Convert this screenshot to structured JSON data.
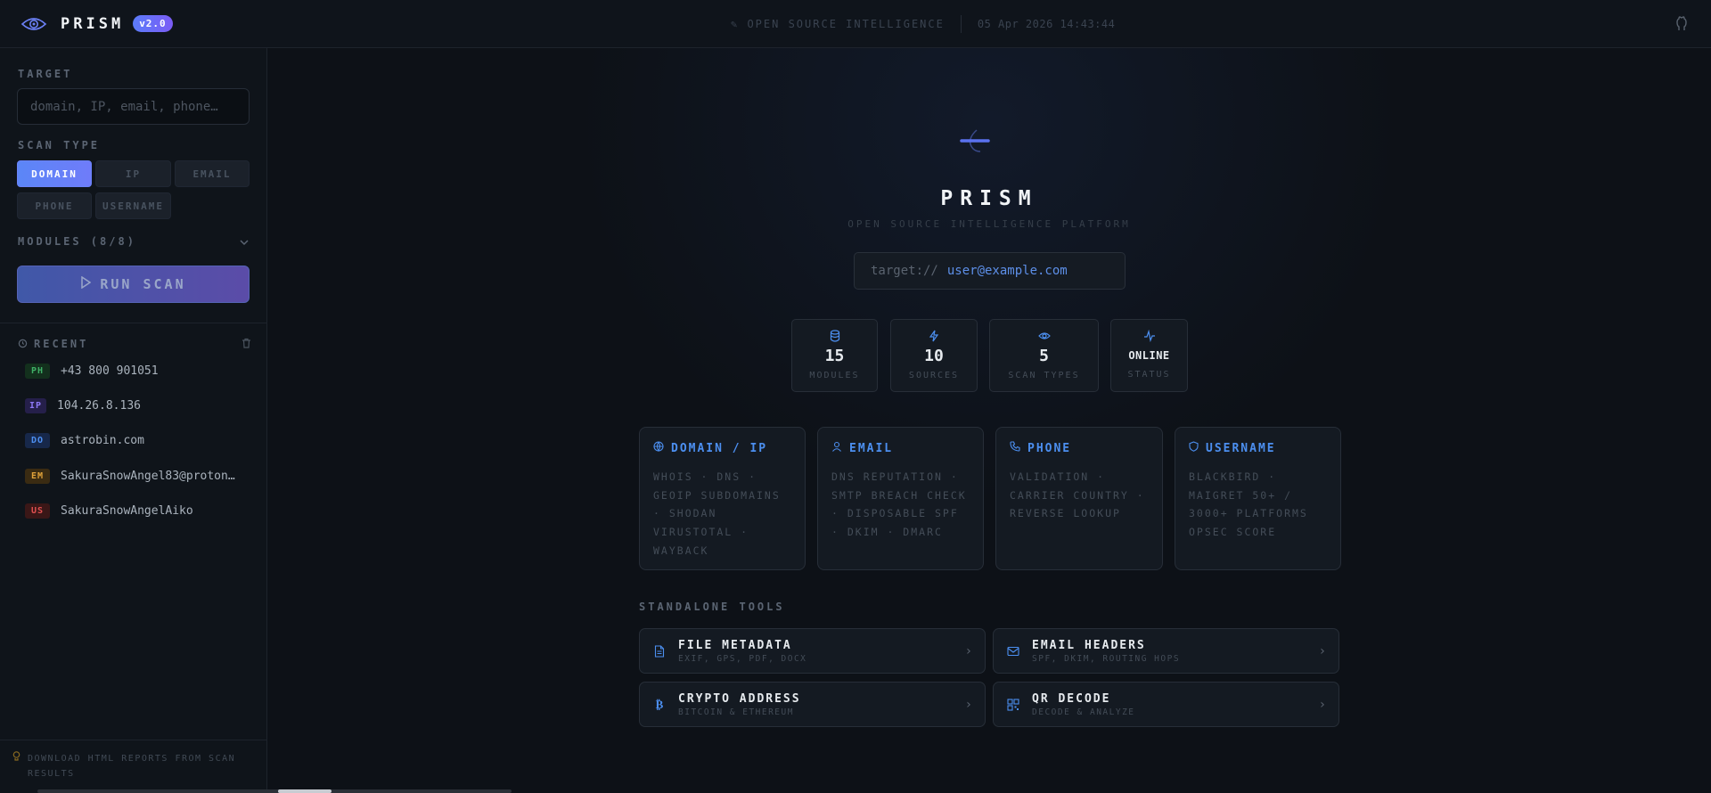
{
  "topbar": {
    "brand": "PRISM",
    "version": "v2.0",
    "tagline": "✎ OPEN SOURCE INTELLIGENCE",
    "datetime": "05 Apr 2026 14:43:44"
  },
  "sidebar": {
    "target_label": "TARGET",
    "target_placeholder": "domain, IP, email, phone…",
    "scan_type_label": "SCAN TYPE",
    "scan_types": [
      "DOMAIN",
      "IP",
      "EMAIL",
      "PHONE",
      "USERNAME"
    ],
    "active_scan_type": "DOMAIN",
    "modules_label": "MODULES (8/8)",
    "run_label": "RUN SCAN",
    "recent_label": "RECENT",
    "recent": [
      {
        "tag": "PH",
        "value": "+43 800 901051"
      },
      {
        "tag": "IP",
        "value": "104.26.8.136"
      },
      {
        "tag": "DO",
        "value": "astrobin.com"
      },
      {
        "tag": "EM",
        "value": "SakuraSnowAngel83@proton…"
      },
      {
        "tag": "US",
        "value": "SakuraSnowAngelAiko"
      }
    ],
    "tip": "DOWNLOAD HTML REPORTS FROM SCAN RESULTS"
  },
  "hero": {
    "title": "PRISM",
    "subtitle": "OPEN SOURCE INTELLIGENCE PLATFORM",
    "target_prefix": "target://",
    "target_value": "user@example.com"
  },
  "stats": [
    {
      "value": "15",
      "label": "MODULES"
    },
    {
      "value": "10",
      "label": "SOURCES"
    },
    {
      "value": "5",
      "label": "SCAN TYPES"
    },
    {
      "value": "ONLINE",
      "label": "STATUS"
    }
  ],
  "cards": [
    {
      "title": "DOMAIN / IP",
      "body": "WHOIS · DNS · GEOIP SUBDOMAINS · SHODAN VIRUSTOTAL · WAYBACK"
    },
    {
      "title": "EMAIL",
      "body": "DNS REPUTATION · SMTP BREACH CHECK · DISPOSABLE SPF · DKIM · DMARC"
    },
    {
      "title": "PHONE",
      "body": "VALIDATION · CARRIER COUNTRY · REVERSE LOOKUP"
    },
    {
      "title": "USERNAME",
      "body": "BLACKBIRD · MAIGRET 50+ / 3000+ PLATFORMS OPSEC SCORE"
    }
  ],
  "standalone_label": "STANDALONE TOOLS",
  "tools": [
    {
      "title": "FILE METADATA",
      "sub": "EXIF, GPS, PDF, DOCX"
    },
    {
      "title": "EMAIL HEADERS",
      "sub": "SPF, DKIM, ROUTING HOPS"
    },
    {
      "title": "CRYPTO ADDRESS",
      "sub": "BITCOIN & ETHEREUM"
    },
    {
      "title": "QR DECODE",
      "sub": "DECODE & ANALYZE"
    }
  ],
  "colors": {
    "accent": "#5b86f7",
    "accent_purple": "#7b5cf5",
    "card_title": "#4c8ff0",
    "background": "#0d1117"
  },
  "icons": {
    "brand": "eye-icon",
    "github": "github-icon",
    "modules_toggle": "chevron-down-icon",
    "run": "play-icon",
    "recent": "history-icon",
    "clear": "trash-icon",
    "tip": "lightbulb-icon"
  }
}
